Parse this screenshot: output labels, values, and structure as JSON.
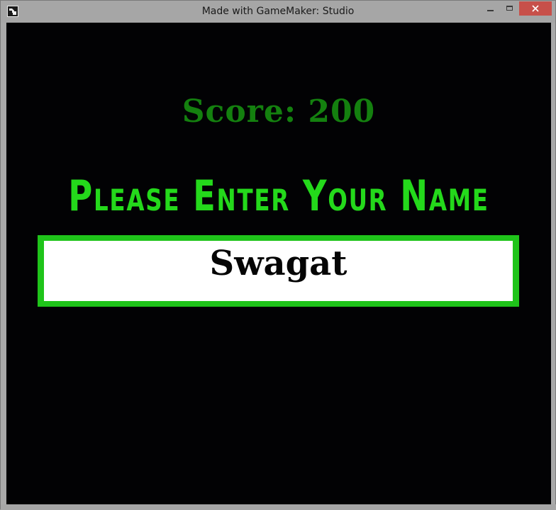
{
  "window": {
    "title": "Made with GameMaker: Studio",
    "icon": "gamemaker-icon",
    "controls": [
      "minimize-icon",
      "maximize-icon",
      "close-icon"
    ],
    "close_color": "#c7504a"
  },
  "game": {
    "score_text": "Score: 200",
    "prompt_text": "Please Enter Your Name",
    "name_value": "Swagat",
    "colors": {
      "background": "#020204",
      "score": "#14800f",
      "prompt": "#24d91b",
      "input_border": "#1fc41a",
      "input_fill": "#ffffff"
    }
  }
}
